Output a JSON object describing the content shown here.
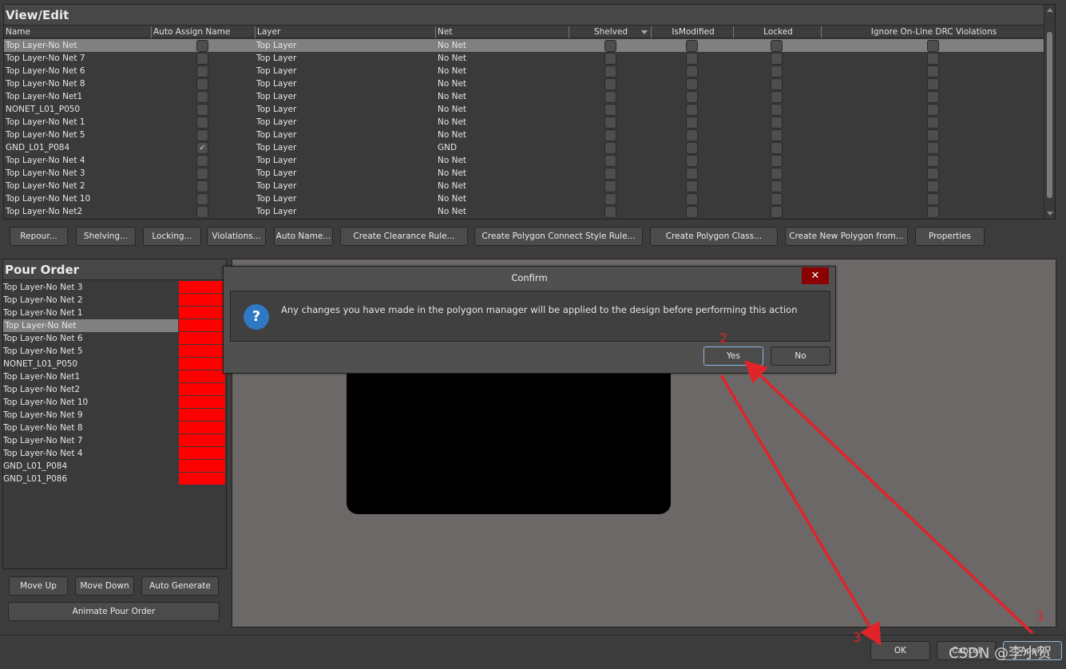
{
  "view_edit": {
    "title": "View/Edit",
    "columns": [
      "Name",
      "Auto Assign Name",
      "Layer",
      "Net",
      "Shelved",
      "IsModified",
      "Locked",
      "Ignore On-Line DRC Violations"
    ],
    "rows": [
      {
        "name": "Top Layer-No Net",
        "auto_assign": false,
        "layer": "Top Layer",
        "net": "No Net",
        "shelved": false,
        "modified": false,
        "locked": false,
        "ignore_drc": false,
        "selected": true
      },
      {
        "name": "Top Layer-No Net 7",
        "auto_assign": false,
        "layer": "Top Layer",
        "net": "No Net",
        "shelved": false,
        "modified": false,
        "locked": false,
        "ignore_drc": false
      },
      {
        "name": "Top Layer-No Net 6",
        "auto_assign": false,
        "layer": "Top Layer",
        "net": "No Net",
        "shelved": false,
        "modified": false,
        "locked": false,
        "ignore_drc": false
      },
      {
        "name": "Top Layer-No Net 8",
        "auto_assign": false,
        "layer": "Top Layer",
        "net": "No Net",
        "shelved": false,
        "modified": false,
        "locked": false,
        "ignore_drc": false
      },
      {
        "name": "Top Layer-No Net1",
        "auto_assign": false,
        "layer": "Top Layer",
        "net": "No Net",
        "shelved": false,
        "modified": false,
        "locked": false,
        "ignore_drc": false
      },
      {
        "name": "NONET_L01_P050",
        "auto_assign": false,
        "layer": "Top Layer",
        "net": "No Net",
        "shelved": false,
        "modified": false,
        "locked": false,
        "ignore_drc": false
      },
      {
        "name": "Top Layer-No Net 1",
        "auto_assign": false,
        "layer": "Top Layer",
        "net": "No Net",
        "shelved": false,
        "modified": false,
        "locked": false,
        "ignore_drc": false
      },
      {
        "name": "Top Layer-No Net 5",
        "auto_assign": false,
        "layer": "Top Layer",
        "net": "No Net",
        "shelved": false,
        "modified": false,
        "locked": false,
        "ignore_drc": false
      },
      {
        "name": "GND_L01_P084",
        "auto_assign": true,
        "layer": "Top Layer",
        "net": "GND",
        "shelved": false,
        "modified": false,
        "locked": false,
        "ignore_drc": false
      },
      {
        "name": "Top Layer-No Net 4",
        "auto_assign": false,
        "layer": "Top Layer",
        "net": "No Net",
        "shelved": false,
        "modified": false,
        "locked": false,
        "ignore_drc": false
      },
      {
        "name": "Top Layer-No Net 3",
        "auto_assign": false,
        "layer": "Top Layer",
        "net": "No Net",
        "shelved": false,
        "modified": false,
        "locked": false,
        "ignore_drc": false
      },
      {
        "name": "Top Layer-No Net 2",
        "auto_assign": false,
        "layer": "Top Layer",
        "net": "No Net",
        "shelved": false,
        "modified": false,
        "locked": false,
        "ignore_drc": false
      },
      {
        "name": "Top Layer-No Net 10",
        "auto_assign": false,
        "layer": "Top Layer",
        "net": "No Net",
        "shelved": false,
        "modified": false,
        "locked": false,
        "ignore_drc": false
      },
      {
        "name": "Top Layer-No Net2",
        "auto_assign": false,
        "layer": "Top Layer",
        "net": "No Net",
        "shelved": false,
        "modified": false,
        "locked": false,
        "ignore_drc": false
      }
    ],
    "check_glyph": "✓"
  },
  "toolbar": {
    "buttons": [
      "Repour...",
      "Shelving...",
      "Locking...",
      "Violations...",
      "Auto Name...",
      "Create Clearance Rule...",
      "Create Polygon Connect Style Rule...",
      "Create Polygon Class...",
      "Create New Polygon from...",
      "Properties"
    ]
  },
  "pour_order": {
    "title": "Pour Order",
    "swatch_color": "#ff0000",
    "items": [
      {
        "name": "Top Layer-No Net 3"
      },
      {
        "name": "Top Layer-No Net 2"
      },
      {
        "name": "Top Layer-No Net 1"
      },
      {
        "name": "Top Layer-No Net",
        "selected": true
      },
      {
        "name": "Top Layer-No Net 6"
      },
      {
        "name": "Top Layer-No Net 5"
      },
      {
        "name": "NONET_L01_P050"
      },
      {
        "name": "Top Layer-No Net1"
      },
      {
        "name": "Top Layer-No Net2"
      },
      {
        "name": "Top Layer-No Net 10"
      },
      {
        "name": "Top Layer-No Net 9"
      },
      {
        "name": "Top Layer-No Net 8"
      },
      {
        "name": "Top Layer-No Net 7"
      },
      {
        "name": "Top Layer-No Net 4"
      },
      {
        "name": "GND_L01_P084"
      },
      {
        "name": "GND_L01_P086"
      }
    ],
    "move_up": "Move Up",
    "move_down": "Move Down",
    "auto_generate": "Auto Generate",
    "animate": "Animate Pour Order"
  },
  "footer": {
    "ok": "OK",
    "cancel": "Cancel",
    "apply": "Apply"
  },
  "dialog": {
    "title": "Confirm",
    "close_glyph": "✕",
    "icon_glyph": "?",
    "message": "Any changes you have made in the polygon manager will be applied to the design before performing this action",
    "yes": "Yes",
    "no": "No"
  },
  "annotations": {
    "step1": "1",
    "step2": "2",
    "step3": "3",
    "color": "#e0242a",
    "watermark": "CSDN @李小贺"
  }
}
